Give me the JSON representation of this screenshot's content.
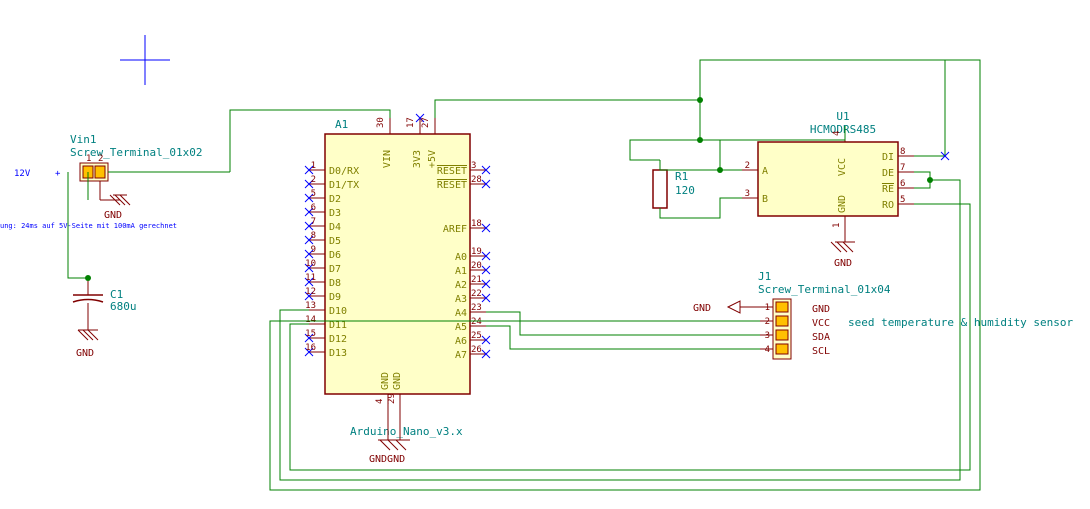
{
  "vin1": {
    "ref": "Vin1",
    "value": "Screw_Terminal_01x02",
    "p1": "1",
    "p2": "2",
    "label12v": "12V",
    "plus": "+",
    "gnd": "GND",
    "footnote": "ung: 24ms auf 5V-Seite mit 100mA gerechnet"
  },
  "c1": {
    "ref": "C1",
    "value": "680u",
    "gnd": "GND"
  },
  "arduino": {
    "ref": "A1",
    "value": "Arduino_Nano_v3.x",
    "vin": "VIN",
    "v3v3": "3V3",
    "v5v": "+5V",
    "reset1": "RESET",
    "reset2": "RESET",
    "d0": "D0/RX",
    "d1": "D1/TX",
    "d2": "D2",
    "d3": "D3",
    "d4": "D4",
    "d5": "D5",
    "d6": "D6",
    "d7": "D7",
    "d8": "D8",
    "d9": "D9",
    "d10": "D10",
    "d11": "D11",
    "d12": "D12",
    "d13": "D13",
    "aref": "AREF",
    "a0": "A0",
    "a1": "A1",
    "a2": "A2",
    "a3": "A3",
    "a4": "A4",
    "a5": "A5",
    "a6": "A6",
    "a7": "A7",
    "gnd1": "GND",
    "gnd2": "GND",
    "gndbot": "GNDGND",
    "pn1": "1",
    "pn2": "2",
    "pn3": "3",
    "pn4": "4",
    "pn5": "5",
    "pn6": "6",
    "pn7": "7",
    "pn8": "8",
    "pn9": "9",
    "pn10": "10",
    "pn11": "11",
    "pn12": "12",
    "pn13": "13",
    "pn14": "14",
    "pn15": "15",
    "pn16": "16",
    "pn17": "17",
    "pn18": "18",
    "pn19": "19",
    "pn20": "20",
    "pn21": "21",
    "pn22": "22",
    "pn23": "23",
    "pn24": "24",
    "pn25": "25",
    "pn26": "26",
    "pn27": "27",
    "pn28": "28",
    "pn29": "29",
    "pn30": "30"
  },
  "r1": {
    "ref": "R1",
    "value": "120"
  },
  "u1": {
    "ref": "U1",
    "value": "HCMODRS485",
    "a": "A",
    "b": "B",
    "di": "DI",
    "de": "DE",
    "re": "RE",
    "ro": "RO",
    "vcc": "VCC",
    "gnd": "GND",
    "gndlbl": "GND",
    "p1": "1",
    "p2": "2",
    "p3": "3",
    "p4": "4",
    "p5": "5",
    "p6": "6",
    "p7": "7",
    "p8": "8"
  },
  "j1": {
    "ref": "J1",
    "value": "Screw_Terminal_01x04",
    "gnd": "GND",
    "vcc": "VCC",
    "sda": "SDA",
    "scl": "SCL",
    "gndlbl": "GND",
    "p1": "1",
    "p2": "2",
    "p3": "3",
    "p4": "4",
    "note": "seed temperature & humidity sensor"
  }
}
